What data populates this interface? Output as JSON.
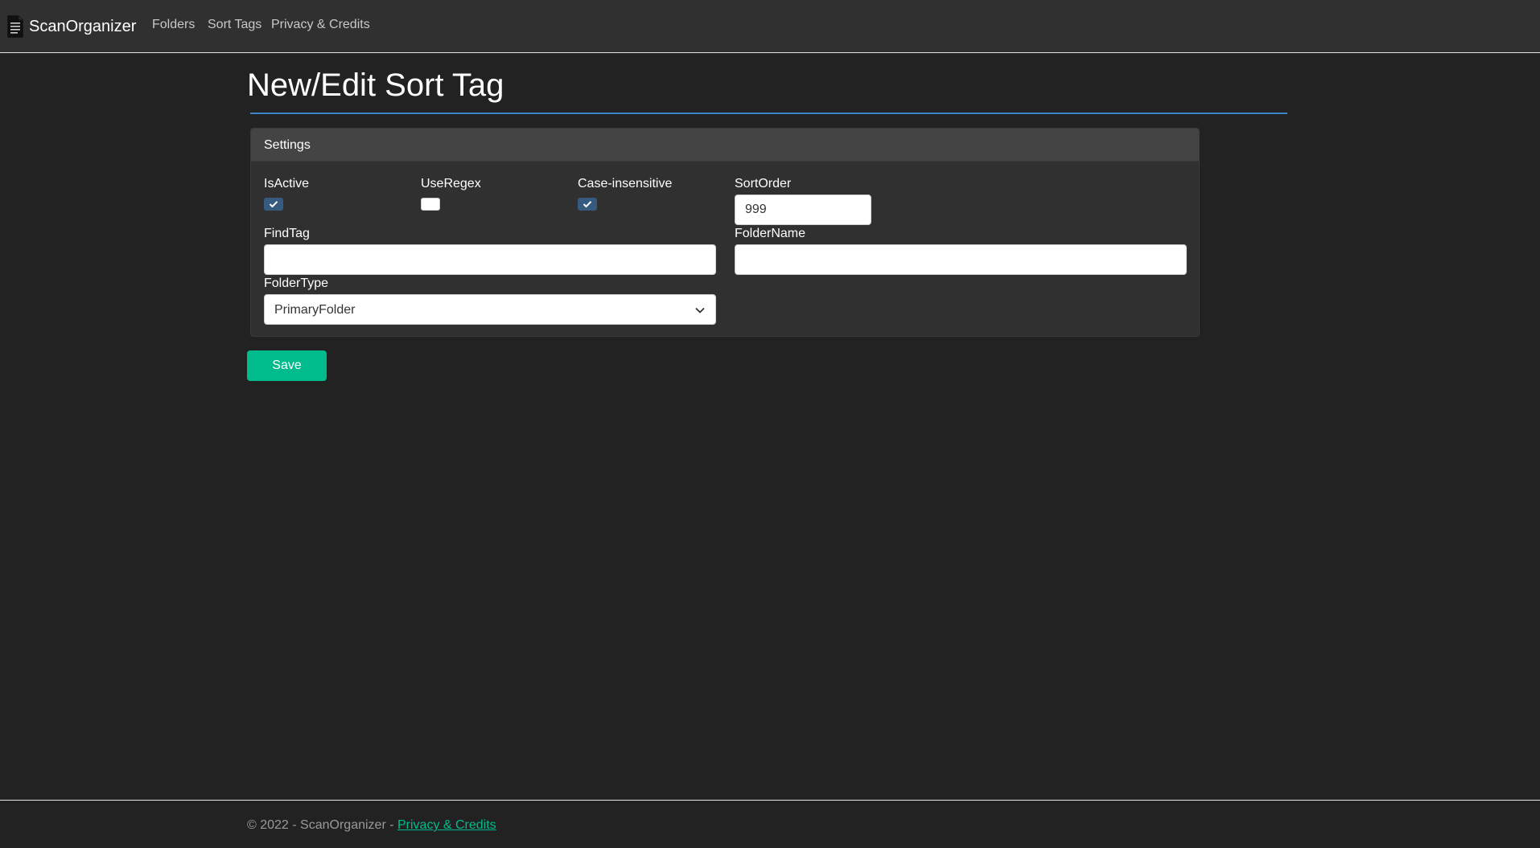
{
  "navbar": {
    "brand": "ScanOrganizer",
    "brand_icon": "document-icon",
    "links": [
      "Folders",
      "Sort Tags",
      "Privacy & Credits"
    ]
  },
  "page": {
    "title": "New/Edit Sort Tag"
  },
  "card": {
    "header": "Settings",
    "fields": {
      "is_active": {
        "label": "IsActive",
        "checked": true
      },
      "use_regex": {
        "label": "UseRegex",
        "checked": false
      },
      "case_insensitive": {
        "label": "Case-insensitive",
        "checked": true
      },
      "sort_order": {
        "label": "SortOrder",
        "value": "999"
      },
      "find_tag": {
        "label": "FindTag",
        "value": ""
      },
      "folder_name": {
        "label": "FolderName",
        "value": ""
      },
      "folder_type": {
        "label": "FolderType",
        "selected": "PrimaryFolder"
      }
    }
  },
  "actions": {
    "save_label": "Save"
  },
  "footer": {
    "text": "© 2022 - ScanOrganizer - ",
    "link": "Privacy & Credits"
  },
  "colors": {
    "background": "#222222",
    "navbar": "#303030",
    "accent_primary": "#375a7f",
    "accent_success": "#00bc8c",
    "title_rule": "#3b86c8"
  }
}
